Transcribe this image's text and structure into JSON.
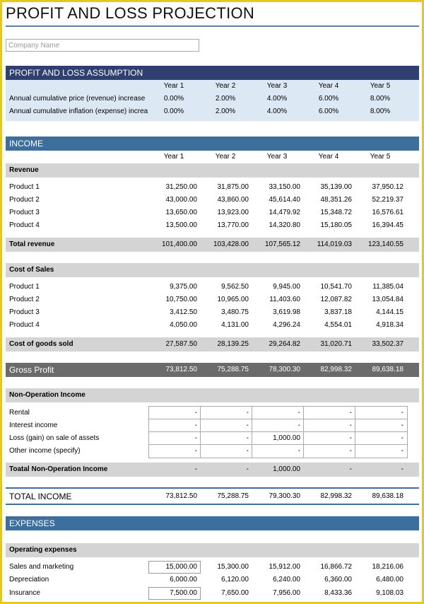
{
  "title": "PROFIT AND LOSS PROJECTION",
  "company_placeholder": "Company Name",
  "years": [
    "Year 1",
    "Year 2",
    "Year 3",
    "Year 4",
    "Year 5"
  ],
  "assumption": {
    "heading": "PROFIT AND LOSS ASSUMPTION",
    "rows": [
      {
        "label": "Annual cumulative price (revenue) increase",
        "values": [
          "0.00%",
          "2.00%",
          "4.00%",
          "6.00%",
          "8.00%"
        ]
      },
      {
        "label": "Annual cumulative inflation (expense) increa",
        "values": [
          "0.00%",
          "2.00%",
          "4.00%",
          "6.00%",
          "8.00%"
        ]
      }
    ]
  },
  "income": {
    "heading": "INCOME",
    "revenue": {
      "heading": "Revenue",
      "rows": [
        {
          "label": "Product 1",
          "values": [
            "31,250.00",
            "31,875.00",
            "33,150.00",
            "35,139.00",
            "37,950.12"
          ]
        },
        {
          "label": "Product 2",
          "values": [
            "43,000.00",
            "43,860.00",
            "45,614.40",
            "48,351.26",
            "52,219.37"
          ]
        },
        {
          "label": "Product 3",
          "values": [
            "13,650.00",
            "13,923.00",
            "14,479.92",
            "15,348.72",
            "16,576.61"
          ]
        },
        {
          "label": "Product 4",
          "values": [
            "13,500.00",
            "13,770.00",
            "14,320.80",
            "15,180.05",
            "16,394.45"
          ]
        }
      ],
      "total": {
        "label": "Total revenue",
        "values": [
          "101,400.00",
          "103,428.00",
          "107,565.12",
          "114,019.03",
          "123,140.55"
        ]
      }
    },
    "cost_of_sales": {
      "heading": "Cost of Sales",
      "rows": [
        {
          "label": "Product 1",
          "values": [
            "9,375.00",
            "9,562.50",
            "9,945.00",
            "10,541.70",
            "11,385.04"
          ]
        },
        {
          "label": "Product 2",
          "values": [
            "10,750.00",
            "10,965.00",
            "11,403.60",
            "12,087.82",
            "13,054.84"
          ]
        },
        {
          "label": "Product 3",
          "values": [
            "3,412.50",
            "3,480.75",
            "3,619.98",
            "3,837.18",
            "4,144.15"
          ]
        },
        {
          "label": "Product 4",
          "values": [
            "4,050.00",
            "4,131.00",
            "4,296.24",
            "4,554.01",
            "4,918.34"
          ]
        }
      ],
      "total": {
        "label": "Cost of goods sold",
        "values": [
          "27,587.50",
          "28,139.25",
          "29,264.82",
          "31,020.71",
          "33,502.37"
        ]
      }
    },
    "gross_profit": {
      "label": "Gross Profit",
      "values": [
        "73,812.50",
        "75,288.75",
        "78,300.30",
        "82,998.32",
        "89,638.18"
      ]
    },
    "non_operation": {
      "heading": "Non-Operation Income",
      "rows": [
        {
          "label": "Rental",
          "values": [
            "-",
            "-",
            "-",
            "-",
            "-"
          ]
        },
        {
          "label": "Interest income",
          "values": [
            "-",
            "-",
            "-",
            "-",
            "-"
          ]
        },
        {
          "label": "Loss (gain) on sale of assets",
          "values": [
            "-",
            "-",
            "1,000.00",
            "-",
            "-"
          ]
        },
        {
          "label": "Other income (specify)",
          "values": [
            "-",
            "-",
            "-",
            "-",
            "-"
          ]
        }
      ],
      "total": {
        "label": "Toatal Non-Operation Income",
        "values": [
          "-",
          "-",
          "1,000.00",
          "-",
          "-"
        ]
      }
    },
    "total_income": {
      "label": "TOTAL INCOME",
      "values": [
        "73,812.50",
        "75,288.75",
        "79,300.30",
        "82,998.32",
        "89,638.18"
      ]
    }
  },
  "expenses": {
    "heading": "EXPENSES",
    "operating": {
      "heading": "Operating expenses",
      "rows": [
        {
          "label": "Sales and marketing",
          "values": [
            "15,000.00",
            "15,300.00",
            "15,912.00",
            "16,866.72",
            "18,216.06"
          ]
        },
        {
          "label": "Depreciation",
          "values": [
            "6,000.00",
            "6,120.00",
            "6,240.00",
            "6,360.00",
            "6,480.00"
          ]
        },
        {
          "label": "Insurance",
          "values": [
            "7,500.00",
            "7,650.00",
            "7,956.00",
            "8,433.36",
            "9,108.03"
          ]
        }
      ]
    }
  },
  "colors": {
    "frame": "#e6c81e",
    "dark_band": "#2f3f70",
    "blue_band": "#3c6e9e",
    "assumption_bg": "#dde8f5",
    "subtotal_bg": "#d4d4d4",
    "gross_profit_bg": "#6b6b6b"
  }
}
